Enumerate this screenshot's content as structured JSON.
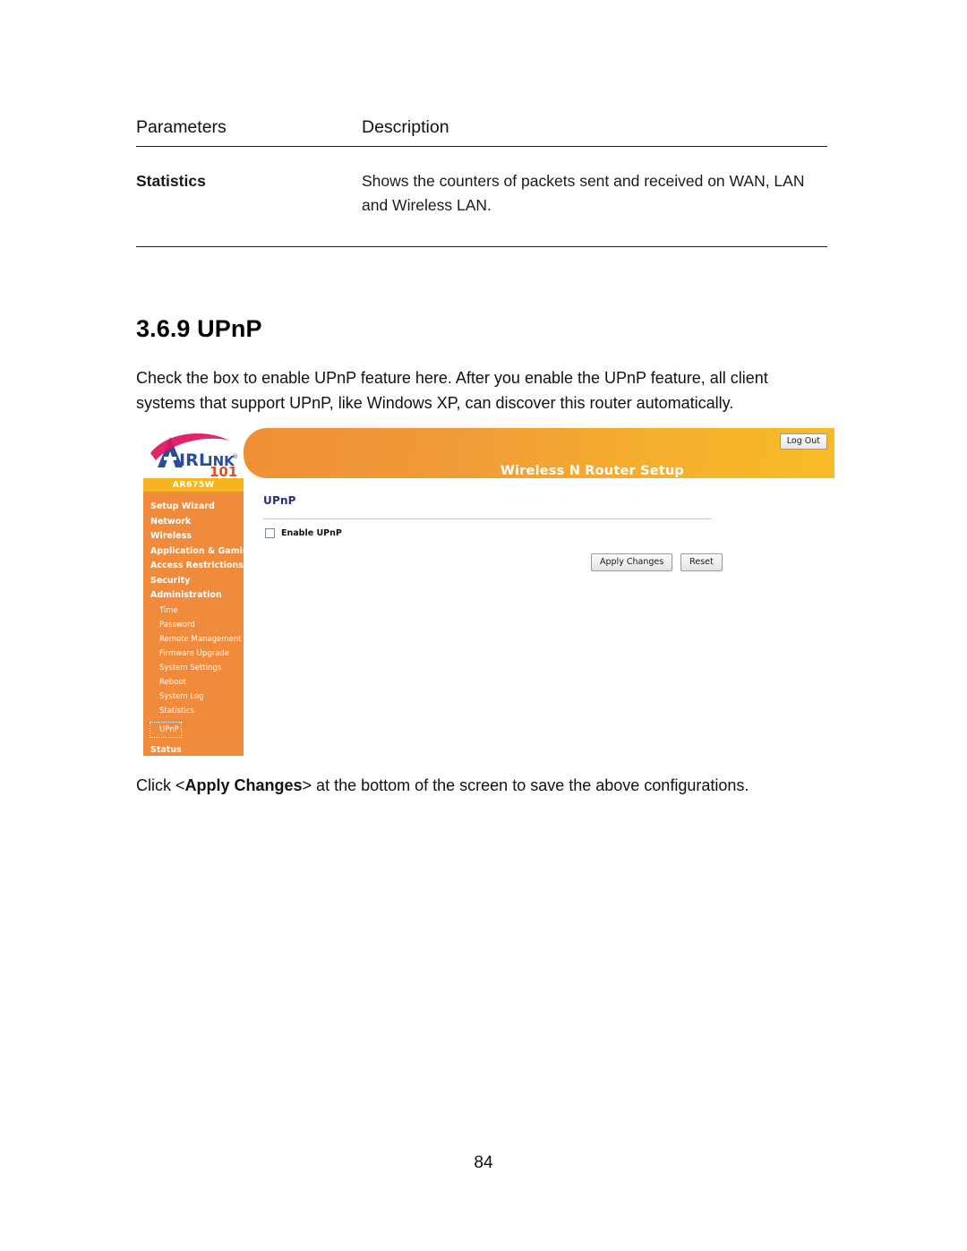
{
  "document": {
    "page_number": "84",
    "section_heading": "3.6.9 UPnP",
    "intro_paragraph": "Check the box to enable UPnP feature here. After you enable the UPnP feature, all client systems that support UPnP, like Windows XP, can discover this router automatically.",
    "closing_line_prefix": "Click <",
    "closing_line_bold": "Apply Changes",
    "closing_line_suffix": "> at the bottom of the screen to save the above configurations."
  },
  "param_table": {
    "headers": [
      "Parameters",
      "Description"
    ],
    "rows": [
      {
        "parameter": "Statistics",
        "description": "Shows the counters of packets sent and received on WAN, LAN and Wireless LAN."
      }
    ]
  },
  "router_ui": {
    "brand": {
      "name_primary": "A",
      "name_rest": "IRLINK",
      "registered_mark": "®",
      "suffix": "101"
    },
    "model": "AR675W",
    "header_title": "Wireless N Router Setup",
    "logout_label": "Log Out",
    "menu": [
      {
        "label": "Setup Wizard",
        "type": "main"
      },
      {
        "label": "Network",
        "type": "main"
      },
      {
        "label": "Wireless",
        "type": "main"
      },
      {
        "label": "Application & Gaming",
        "type": "main"
      },
      {
        "label": "Access Restrictions",
        "type": "main"
      },
      {
        "label": "Security",
        "type": "main"
      },
      {
        "label": "Administration",
        "type": "main"
      },
      {
        "label": "Time",
        "type": "sub"
      },
      {
        "label": "Password",
        "type": "sub"
      },
      {
        "label": "Remote Management",
        "type": "sub"
      },
      {
        "label": "Firmware Upgrade",
        "type": "sub"
      },
      {
        "label": "System Settings",
        "type": "sub"
      },
      {
        "label": "Reboot",
        "type": "sub"
      },
      {
        "label": "System Log",
        "type": "sub"
      },
      {
        "label": "Statistics",
        "type": "sub"
      },
      {
        "label": "UPnP",
        "type": "sub",
        "selected": true
      },
      {
        "label": "Status",
        "type": "main"
      }
    ],
    "content": {
      "title": "UPnP",
      "checkbox_label": "Enable UPnP",
      "checkbox_checked": false,
      "apply_label": "Apply Changes",
      "reset_label": "Reset"
    },
    "colors": {
      "header_orange_left": "#ef8f36",
      "header_orange_right": "#f8bc27",
      "sidebar_orange": "#f08a3c",
      "model_badge": "#f7b320",
      "content_title": "#2b2f7a",
      "logo_blue": "#2b4b9b",
      "logo_swoosh": "#e0115f",
      "logo_101": "#e8491d"
    }
  }
}
